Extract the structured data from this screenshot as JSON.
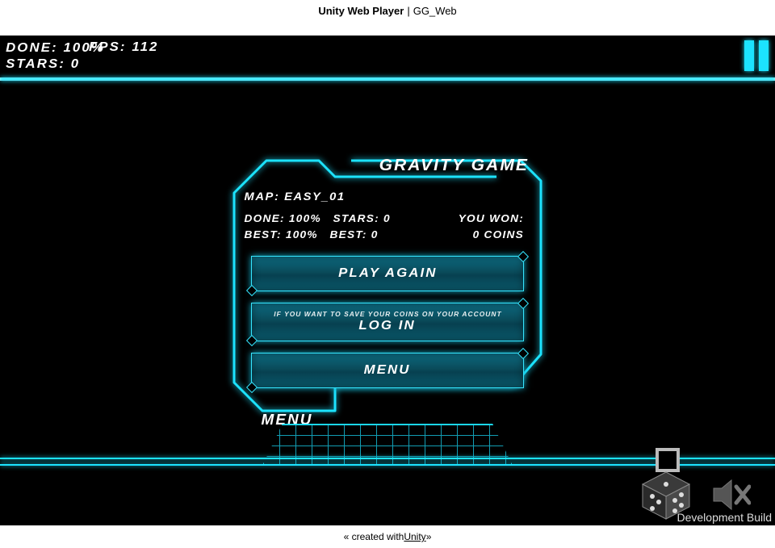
{
  "page_title": {
    "prefix": "Unity Web Player",
    "sep": "|",
    "app": "GG_Web"
  },
  "footer": {
    "pre": "« created with ",
    "link": "Unity",
    "post": " »"
  },
  "hud": {
    "done_label": "Done:",
    "done_value": "100%",
    "fps_label": "FPS:",
    "fps_value": "112",
    "stars_label": "Stars:",
    "stars_value": "0"
  },
  "panel": {
    "title": "GRAVITY GAME",
    "map_label": "Map:",
    "map_value": "Easy_01",
    "row1": {
      "done": "Done: 100%",
      "stars": "Stars: 0",
      "won": "You Won:"
    },
    "row2": {
      "best": "Best: 100%",
      "best_stars": "Best: 0",
      "coins": "0 Coins"
    },
    "buttons": {
      "play_again": "PLAY AGAIN",
      "login_hint": "If you want to save your coins on your account",
      "login": "LOG IN",
      "menu": "MENU"
    },
    "footer_label": "MENU"
  },
  "devbuild": "Development Build",
  "colors": {
    "neon": "#1ce3ff"
  }
}
